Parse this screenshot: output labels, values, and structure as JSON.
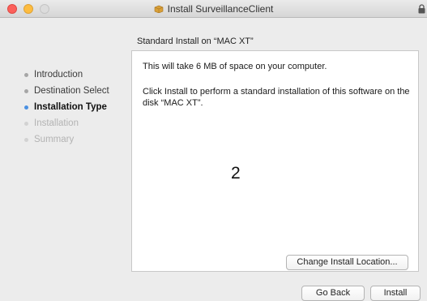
{
  "window": {
    "title": "Install SurveillanceClient"
  },
  "icons": {
    "package": "package-icon",
    "lock": "lock-icon"
  },
  "colors": {
    "close": "#fc605b",
    "minimize": "#fdbc40",
    "current_step_dot": "#4a90e2"
  },
  "main": {
    "heading": "Standard Install on “MAC XT”",
    "space_text": "This will take 6 MB of space on your computer.",
    "instruction_text": "Click Install to perform a standard installation of this software on the disk “MAC XT”.",
    "annotation": "2",
    "change_location_label": "Change Install Location..."
  },
  "sidebar": {
    "steps": [
      {
        "label": "Introduction",
        "state": "done"
      },
      {
        "label": "Destination Select",
        "state": "done"
      },
      {
        "label": "Installation Type",
        "state": "current"
      },
      {
        "label": "Installation",
        "state": "pending"
      },
      {
        "label": "Summary",
        "state": "pending"
      }
    ]
  },
  "footer": {
    "back_label": "Go Back",
    "install_label": "Install"
  }
}
